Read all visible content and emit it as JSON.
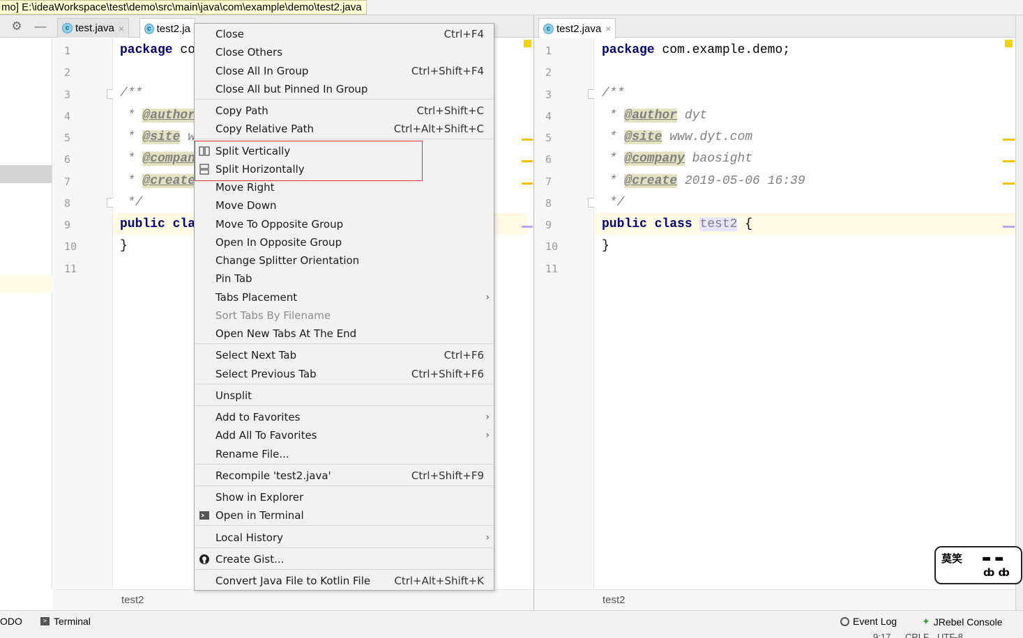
{
  "window": {
    "path_tooltip": "mo] E:\\ideaWorkspace\\test\\demo\\src\\main\\java\\com\\example\\demo\\test2.java"
  },
  "left_tabs": [
    {
      "label": "test.java",
      "close": "×"
    },
    {
      "label": "test2.ja",
      "close": ""
    }
  ],
  "right_tabs": [
    {
      "label": "test2.java",
      "close": "×"
    }
  ],
  "code": {
    "line_numbers": [
      "1",
      "2",
      "3",
      "4",
      "5",
      "6",
      "7",
      "8",
      "9",
      "10",
      "11"
    ],
    "left": {
      "line1_kw": "package",
      "line1_rest": " co",
      "line3": "/**",
      "line4_star": " * ",
      "line4_tag": "@author",
      "line5_star": " * ",
      "line5_tag": "@site",
      "line5_rest": " w",
      "line6_star": " * ",
      "line6_tag": "@compan",
      "line7_star": " * ",
      "line7_tag": "@create",
      "line8": " */",
      "line9_kw": "public cla",
      "line10": "}"
    },
    "right": {
      "line1_kw": "package",
      "line1_rest": " com.example.demo;",
      "line3": "/**",
      "line4_star": " * ",
      "line4_tag": "@author",
      "line4_rest": " dyt",
      "line5_star": " * ",
      "line5_tag": "@site",
      "line5_rest": " www.dyt.com",
      "line6_star": " * ",
      "line6_tag": "@company",
      "line6_rest": " baosight",
      "line7_star": " * ",
      "line7_tag": "@create",
      "line7_rest": " 2019-05-06 16:39",
      "line8": " */",
      "line9_kw": "public class",
      "line9_space": " ",
      "line9_id": "test2",
      "line9_rest": " {",
      "line10": "}"
    }
  },
  "breadcrumb": {
    "left": "test2",
    "right": "test2"
  },
  "context_menu": {
    "items": [
      {
        "label": "Close",
        "shortcut": "Ctrl+F4"
      },
      {
        "label": "Close Others",
        "shortcut": ""
      },
      {
        "label": "Close All In Group",
        "shortcut": "Ctrl+Shift+F4"
      },
      {
        "label": "Close All but Pinned In Group",
        "shortcut": ""
      },
      {
        "label": "Copy Path",
        "shortcut": "Ctrl+Shift+C"
      },
      {
        "label": "Copy Relative Path",
        "shortcut": "Ctrl+Alt+Shift+C"
      },
      {
        "label": "Split Vertically",
        "shortcut": ""
      },
      {
        "label": "Split Horizontally",
        "shortcut": ""
      },
      {
        "label": "Move Right",
        "shortcut": ""
      },
      {
        "label": "Move Down",
        "shortcut": ""
      },
      {
        "label": "Move To Opposite Group",
        "shortcut": ""
      },
      {
        "label": "Open In Opposite Group",
        "shortcut": ""
      },
      {
        "label": "Change Splitter Orientation",
        "shortcut": ""
      },
      {
        "label": "Pin Tab",
        "shortcut": ""
      },
      {
        "label": "Tabs Placement",
        "shortcut": ""
      },
      {
        "label": "Sort Tabs By Filename",
        "shortcut": ""
      },
      {
        "label": "Open New Tabs At The End",
        "shortcut": ""
      },
      {
        "label": "Select Next Tab",
        "shortcut": "Ctrl+F6"
      },
      {
        "label": "Select Previous Tab",
        "shortcut": "Ctrl+Shift+F6"
      },
      {
        "label": "Unsplit",
        "shortcut": ""
      },
      {
        "label": "Add to Favorites",
        "shortcut": ""
      },
      {
        "label": "Add All To Favorites",
        "shortcut": ""
      },
      {
        "label": "Rename File...",
        "shortcut": ""
      },
      {
        "label": "Recompile 'test2.java'",
        "shortcut": "Ctrl+Shift+F9"
      },
      {
        "label": "Show in Explorer",
        "shortcut": ""
      },
      {
        "label": "Open in Terminal",
        "shortcut": ""
      },
      {
        "label": "Local History",
        "shortcut": ""
      },
      {
        "label": "Create Gist...",
        "shortcut": ""
      },
      {
        "label": "Convert Java File to Kotlin File",
        "shortcut": "Ctrl+Alt+Shift+K"
      }
    ],
    "submenu_arrow": "›"
  },
  "status_bar": {
    "todo": "ODO",
    "terminal": "Terminal",
    "event_log": "Event Log",
    "jrebel": "JRebel Console",
    "position": "9:17",
    "line_sep": "CRLF",
    "encoding": "UTF-8"
  },
  "sticker": {
    "text": "莫笑"
  },
  "colors": {
    "keyword": "#000080",
    "comment": "#808080",
    "highlight_box": "#e03030",
    "menu_bg": "#f2f2f2",
    "current_line": "#fffae3"
  }
}
